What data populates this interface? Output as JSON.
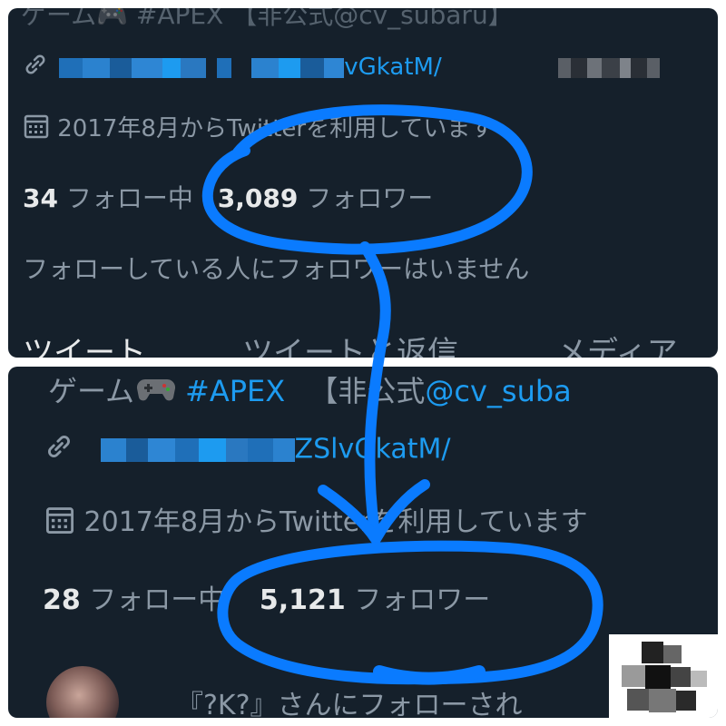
{
  "top_panel": {
    "bio_fragment": "ゲーム🎮 #APEX 【非公式@cv_subaru】",
    "link_text": "vGkatM/",
    "joined": "2017年8月からTwitterを利用しています",
    "following_count": "34",
    "following_label": "フォロー中",
    "followers_count": "3,089",
    "followers_label": "フォロワー",
    "followed_by_note": "フォローしている人にフォロワーはいません",
    "tabs": [
      "ツイート",
      "ツイートと返信",
      "メディア"
    ]
  },
  "bottom_panel": {
    "bio_prefix": "ゲーム",
    "bio_hashtag": "#APEX",
    "bio_bracket": "【非公式",
    "bio_handle": "@cv_suba",
    "link_text": "ZSlvGkatM/",
    "joined": "2017年8月からTwitterを利用しています",
    "following_count": "28",
    "following_label": "フォロー中",
    "followers_count": "5,121",
    "followers_label": "フォロワー",
    "notification_text": "『?K?』さんにフォローされ"
  },
  "colors": {
    "background": "#15202b",
    "annotation": "#0a7bff",
    "link": "#1d9bf0",
    "muted_text": "#8b98a5"
  }
}
